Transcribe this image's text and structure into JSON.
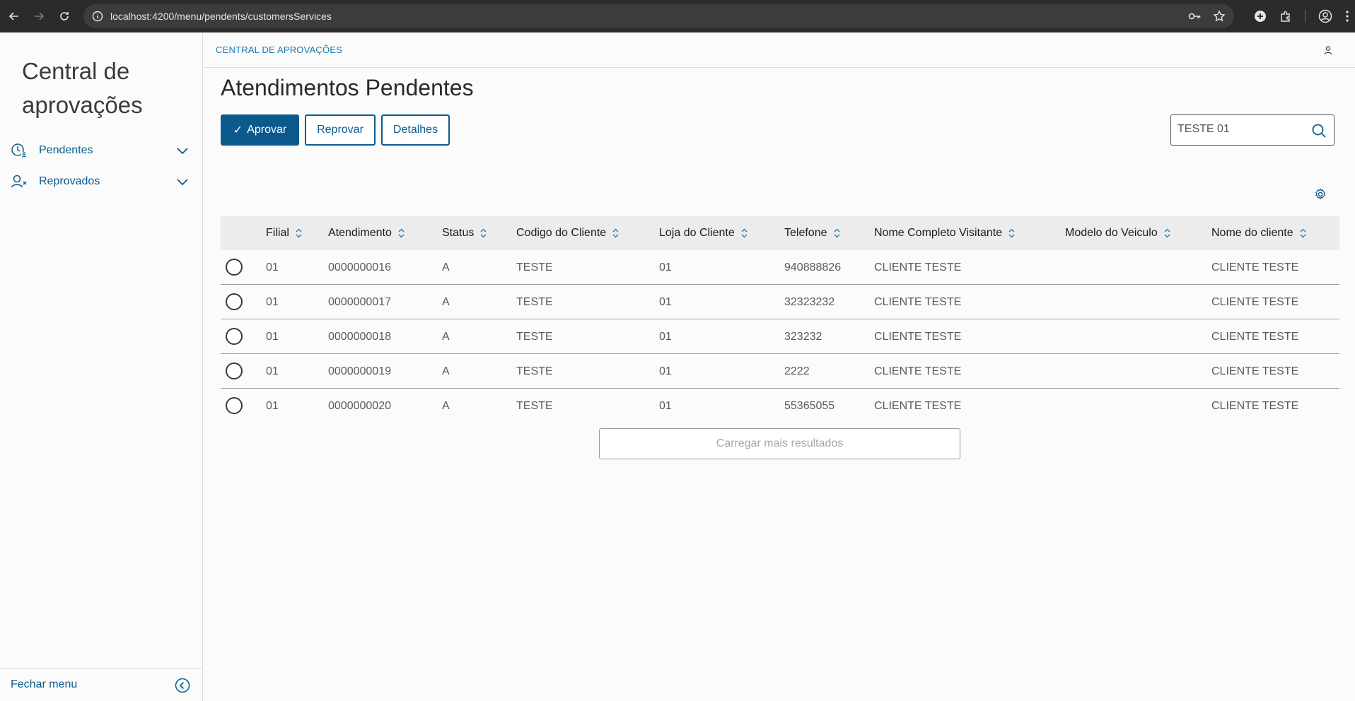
{
  "browser": {
    "url": "localhost:4200/menu/pendents/customersServices"
  },
  "sidebar": {
    "title": "Central de aprovações",
    "items": [
      {
        "label": "Pendentes",
        "icon": "clock-user-icon"
      },
      {
        "label": "Reprovados",
        "icon": "user-x-icon"
      }
    ],
    "footer_label": "Fechar menu"
  },
  "header": {
    "breadcrumb": "CENTRAL DE APROVAÇÕES"
  },
  "main": {
    "title": "Atendimentos Pendentes",
    "actions": {
      "approve": "Aprovar",
      "reject": "Reprovar",
      "details": "Detalhes"
    },
    "search_value": "TESTE 01",
    "load_more": "Carregar mais resultados"
  },
  "table": {
    "columns": [
      "Filial",
      "Atendimento",
      "Status",
      "Codigo do Cliente",
      "Loja do Cliente",
      "Telefone",
      "Nome Completo Visitante",
      "Modelo do Veiculo",
      "Nome do cliente"
    ],
    "rows": [
      [
        "01",
        "0000000016",
        "A",
        "TESTE",
        "01",
        "940888826",
        "CLIENTE TESTE",
        "",
        "CLIENTE TESTE"
      ],
      [
        "01",
        "0000000017",
        "A",
        "TESTE",
        "01",
        "32323232",
        "CLIENTE TESTE",
        "",
        "CLIENTE TESTE"
      ],
      [
        "01",
        "0000000018",
        "A",
        "TESTE",
        "01",
        "323232",
        "CLIENTE TESTE",
        "",
        "CLIENTE TESTE"
      ],
      [
        "01",
        "0000000019",
        "A",
        "TESTE",
        "01",
        "2222",
        "CLIENTE TESTE",
        "",
        "CLIENTE TESTE"
      ],
      [
        "01",
        "0000000020",
        "A",
        "TESTE",
        "01",
        "55365055",
        "CLIENTE TESTE",
        "",
        "CLIENTE TESTE"
      ]
    ]
  },
  "colors": {
    "primary": "#0c5a8d",
    "link": "#1b78b4",
    "header_bg": "#ececec"
  }
}
